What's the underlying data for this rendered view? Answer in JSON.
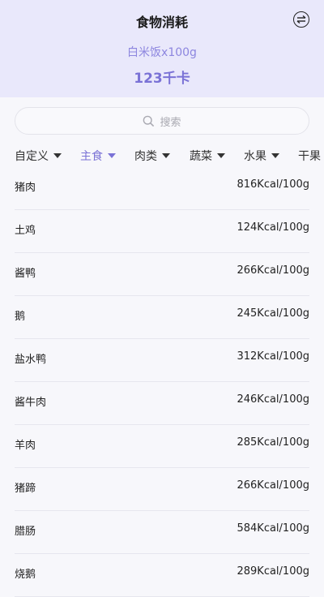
{
  "header": {
    "title": "食物消耗",
    "selected_food": "白米饭x100g",
    "calories": "123千卡"
  },
  "search": {
    "placeholder": "搜索"
  },
  "tabs": [
    {
      "label": "自定义",
      "active": false,
      "has_caret": true
    },
    {
      "label": "主食",
      "active": true,
      "has_caret": true
    },
    {
      "label": "肉类",
      "active": false,
      "has_caret": true
    },
    {
      "label": "蔬菜",
      "active": false,
      "has_caret": true
    },
    {
      "label": "水果",
      "active": false,
      "has_caret": true
    },
    {
      "label": "干果",
      "active": false,
      "has_caret": false
    }
  ],
  "foods": [
    {
      "name": "猪肉",
      "kcal": "816Kcal/100g"
    },
    {
      "name": "土鸡",
      "kcal": "124Kcal/100g"
    },
    {
      "name": "酱鸭",
      "kcal": "266Kcal/100g"
    },
    {
      "name": "鹅",
      "kcal": "245Kcal/100g"
    },
    {
      "name": "盐水鸭",
      "kcal": "312Kcal/100g"
    },
    {
      "name": "酱牛肉",
      "kcal": "246Kcal/100g"
    },
    {
      "name": "羊肉",
      "kcal": "285Kcal/100g"
    },
    {
      "name": "猪蹄",
      "kcal": "266Kcal/100g"
    },
    {
      "name": "腊肠",
      "kcal": "584Kcal/100g"
    },
    {
      "name": "烧鹅",
      "kcal": "289Kcal/100g"
    }
  ],
  "colors": {
    "accent": "#7a72d6",
    "header_bg": "#e9e8fb"
  }
}
